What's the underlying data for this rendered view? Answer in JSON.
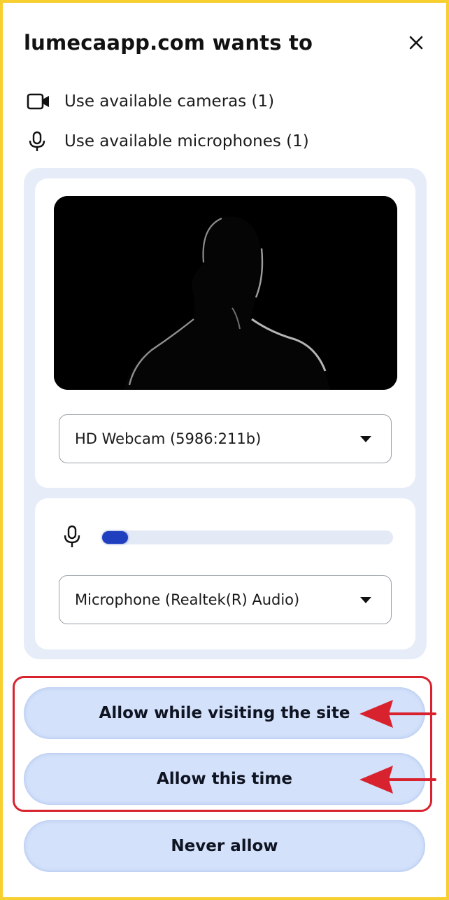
{
  "dialog": {
    "title": "lumecaapp.com wants to",
    "permissions": [
      {
        "icon": "camera-icon",
        "label": "Use available cameras (1)"
      },
      {
        "icon": "microphone-icon",
        "label": "Use available microphones (1)"
      }
    ]
  },
  "camera": {
    "selected": "HD Webcam (5986:211b)"
  },
  "microphone": {
    "selected": "Microphone (Realtek(R) Audio)",
    "level_fraction": 0.09
  },
  "buttons": {
    "allow_site": "Allow while visiting the site",
    "allow_once": "Allow this time",
    "never": "Never allow"
  },
  "colors": {
    "frame_border": "#f7cf2f",
    "panel_bg": "#e6edf9",
    "button_bg": "#d3e1fa",
    "annotation": "#d8232f",
    "mic_level": "#1f3fbf"
  }
}
